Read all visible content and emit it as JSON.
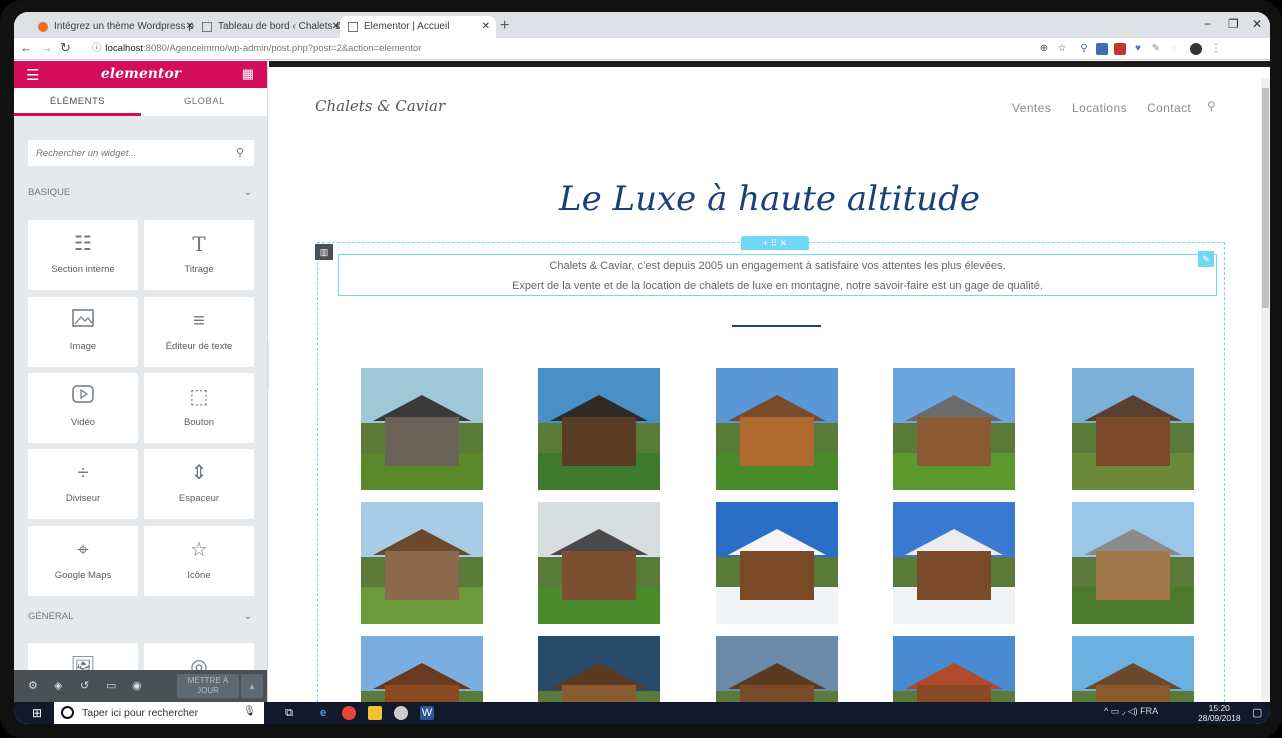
{
  "browser": {
    "tabs": [
      {
        "title": "Intégrez un thème Wordpress p",
        "icon": "oc-favicon-icon"
      },
      {
        "title": "Tableau de bord ‹ Chalets & Cavi",
        "icon": "page-icon"
      },
      {
        "title": "Elementor | Accueil",
        "icon": "page-icon"
      }
    ],
    "new_tab": "+",
    "url_host": "localhost",
    "url_path": ":8080/Agenceimmo/wp-admin/post.php?post=2&action=elementor",
    "minimize": "−",
    "restore": "❐",
    "close": "✕"
  },
  "panel": {
    "logo": "elementor",
    "tabs": [
      "ÉLÉMENTS",
      "GLOBAL"
    ],
    "search_placeholder": "Rechercher un widget...",
    "categories": [
      {
        "label": "BASIQUE"
      },
      {
        "label": "GÉNÉRAL"
      }
    ],
    "widgets": [
      {
        "label": "Section interne",
        "icon": "columns-icon",
        "glyph": "☷"
      },
      {
        "label": "Titrage",
        "icon": "heading-icon",
        "glyph": "T"
      },
      {
        "label": "Image",
        "icon": "image-icon",
        "glyph": "🖼"
      },
      {
        "label": "Éditeur de texte",
        "icon": "text-editor-icon",
        "glyph": "≡"
      },
      {
        "label": "Vidéo",
        "icon": "video-icon",
        "glyph": "▷"
      },
      {
        "label": "Bouton",
        "icon": "button-icon",
        "glyph": "⬚"
      },
      {
        "label": "Diviseur",
        "icon": "divider-icon",
        "glyph": "÷"
      },
      {
        "label": "Espaceur",
        "icon": "spacer-icon",
        "glyph": "⇕"
      },
      {
        "label": "Google Maps",
        "icon": "map-icon",
        "glyph": "⌖"
      },
      {
        "label": "Icône",
        "icon": "star-icon",
        "glyph": "☆"
      }
    ],
    "general_widgets": [
      {
        "icon": "image-box-icon",
        "glyph": "🖼"
      },
      {
        "icon": "icon-box-icon",
        "glyph": "◎"
      }
    ],
    "update_button": "METTRE À JOUR"
  },
  "site": {
    "logo": "Chalets & Caviar",
    "nav": [
      "Ventes",
      "Locations",
      "Contact"
    ],
    "hero_title": "Le Luxe à haute altitude",
    "intro_line1": "Chalets & Caviar, c’est depuis 2005 un engagement à satisfaire vos attentes les plus élevées.",
    "intro_line2": "Expert de la vente et de la location de chalets de luxe en montagne, notre savoir-faire est un gage de qualité.",
    "column_handle": "+  ⠿  ✕"
  },
  "photos": [
    {
      "sky": "#9ec8d8",
      "wall": "#6b6358",
      "grass": "#5a8a2c",
      "roof": "#3a3a3a"
    },
    {
      "sky": "#4a90c8",
      "wall": "#5a3b24",
      "grass": "#3f7a2f",
      "roof": "#2f2a26"
    },
    {
      "sky": "#5b96d6",
      "wall": "#b06a2e",
      "grass": "#4b8a2a",
      "roof": "#7a4b2a"
    },
    {
      "sky": "#6ca6e0",
      "wall": "#8a5a34",
      "grass": "#5c9a30",
      "roof": "#6b6b6b"
    },
    {
      "sky": "#7bb0d8",
      "wall": "#7a4a2a",
      "grass": "#6a8a3a",
      "roof": "#5a4030"
    },
    {
      "sky": "#a8cbe6",
      "wall": "#8a6a4a",
      "grass": "#6a9a3a",
      "roof": "#6a4a2a"
    },
    {
      "sky": "#d8dde0",
      "wall": "#7a5030",
      "grass": "#4a8a2a",
      "roof": "#4a4a4a"
    },
    {
      "sky": "#2a6ec8",
      "wall": "#7a4a26",
      "grass": "#f2f4f6",
      "roof": "#f6f6f6"
    },
    {
      "sky": "#3a7ad0",
      "wall": "#7a4a2a",
      "grass": "#f0f2f4",
      "roof": "#ececec"
    },
    {
      "sky": "#9ac6e8",
      "wall": "#a0784a",
      "grass": "#4a7a2a",
      "roof": "#8a8a8a"
    },
    {
      "sky": "#7aaee0",
      "wall": "#8a4a22",
      "grass": "#5a8a3a",
      "roof": "#6a3a20"
    },
    {
      "sky": "#2a4a6a",
      "wall": "#8a5a30",
      "grass": "#4a6a2a",
      "roof": "#5a3a22"
    },
    {
      "sky": "#6a8aa8",
      "wall": "#7a4a2a",
      "grass": "#5a7a3a",
      "roof": "#5a3a20"
    },
    {
      "sky": "#4a8ad0",
      "wall": "#8a4a26",
      "grass": "#5a8a3a",
      "roof": "#b04a2a"
    },
    {
      "sky": "#6ab0e0",
      "wall": "#8a5a2a",
      "grass": "#4a7a2a",
      "roof": "#6a4a2a"
    }
  ],
  "taskbar": {
    "search_text": "Taper ici pour rechercher",
    "tray": "^  ▭  ◞  ◁)  FRA",
    "time": "15:20",
    "date": "28/09/2018"
  }
}
